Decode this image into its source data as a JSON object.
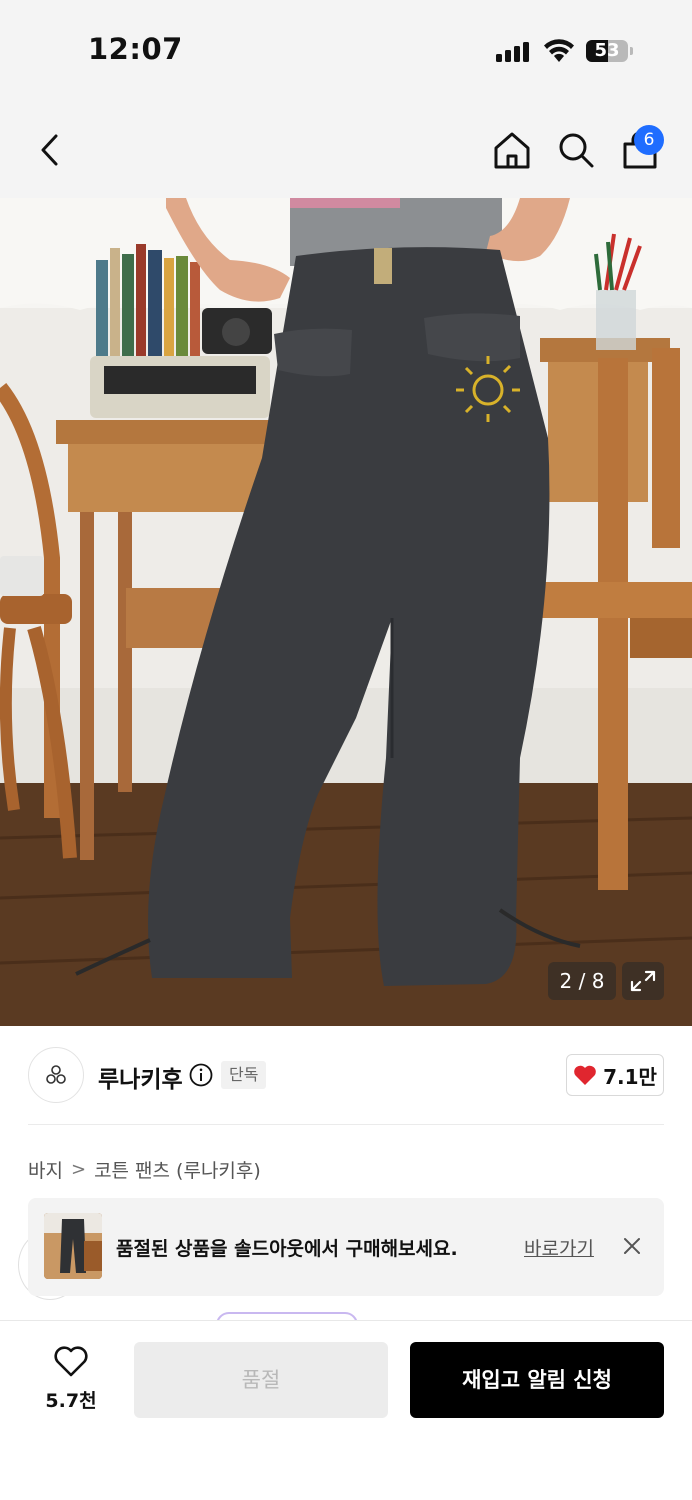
{
  "status_bar": {
    "time": "12:07",
    "battery": "53",
    "battery_level_percent": 53
  },
  "nav": {
    "back_icon": "chevron-left-icon",
    "home_icon": "home-icon",
    "search_icon": "search-icon",
    "cart_icon": "shopping-bag-icon",
    "cart_count": "6"
  },
  "gallery": {
    "counter": "2 / 8",
    "current_image": 2,
    "total_images": 8,
    "expand_icon": "expand-icon"
  },
  "brand": {
    "name": "루나키후",
    "tag": "단독",
    "likes": "7.1만",
    "heart_color": "#e0262f"
  },
  "breadcrumb": {
    "category": "바지",
    "separator": ">",
    "product": "코튼 팬츠 (루나키후)"
  },
  "banner": {
    "text": "품절된 상품을 솔드아웃에서 구매해보세요.",
    "link": "바로가기"
  },
  "bottom_bar": {
    "wish_count": "5.7천",
    "soldout_label": "품절",
    "restock_label": "재입고 알림 신청"
  },
  "colors": {
    "accent_blue": "#1f6dff",
    "primary_black": "#000000"
  }
}
